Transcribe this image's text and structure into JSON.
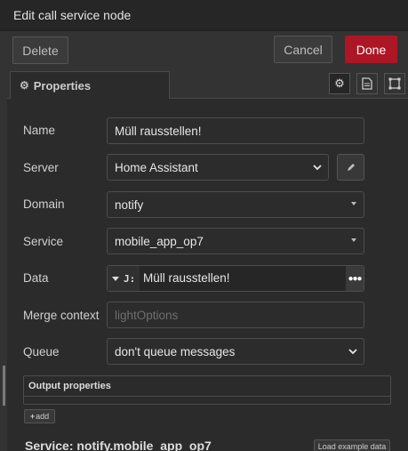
{
  "title": "Edit call service node",
  "buttons": {
    "delete": "Delete",
    "cancel": "Cancel",
    "done": "Done"
  },
  "tabs": {
    "properties": "Properties"
  },
  "form": {
    "name": {
      "label": "Name",
      "value": "Müll rausstellen!"
    },
    "server": {
      "label": "Server",
      "value": "Home Assistant"
    },
    "domain": {
      "label": "Domain",
      "value": "notify"
    },
    "service": {
      "label": "Service",
      "value": "mobile_app_op7"
    },
    "data": {
      "label": "Data",
      "type_icon": "J:",
      "value": "Müll rausstellen!"
    },
    "merge_context": {
      "label": "Merge context",
      "placeholder": "lightOptions"
    },
    "queue": {
      "label": "Queue",
      "value": "don't queue messages"
    }
  },
  "output_properties": {
    "header": "Output properties",
    "add_label": "add"
  },
  "service_info": {
    "title": "Service: notify.mobile_app_op7",
    "load_example": "Load example data"
  },
  "colors": {
    "done": "#ad1625",
    "background": "#2b2b2b",
    "titlebar": "#262626"
  }
}
